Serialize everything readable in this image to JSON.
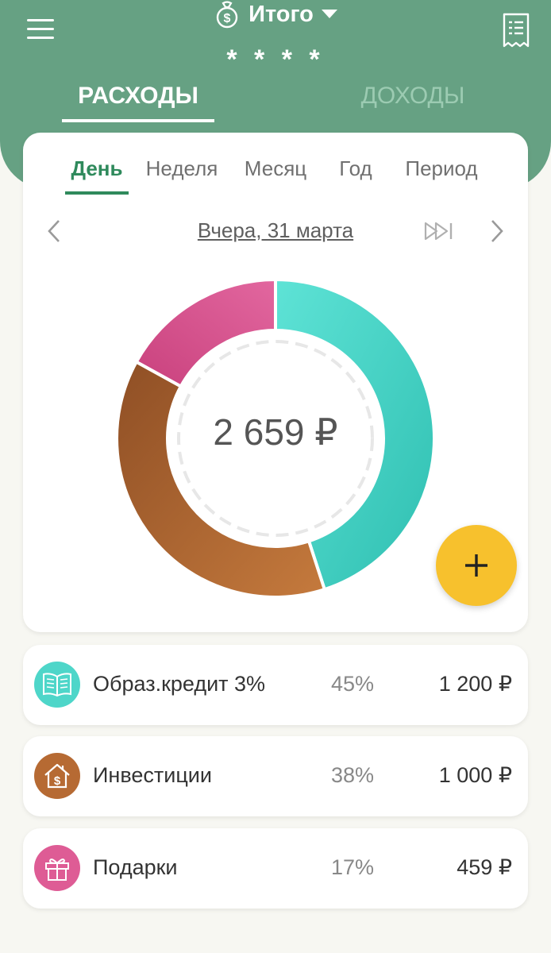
{
  "header": {
    "title": "Итого",
    "masked_balance": "* * * *",
    "tabs": [
      {
        "label": "РАСХОДЫ",
        "active": true
      },
      {
        "label": "ДОХОДЫ",
        "active": false
      }
    ],
    "icons": {
      "menu": "hamburger-icon",
      "wallet": "money-bag-icon",
      "dropdown": "caret-down-icon",
      "receipt": "receipt-icon"
    }
  },
  "period": {
    "tabs": [
      {
        "label": "День",
        "active": true
      },
      {
        "label": "Неделя",
        "active": false
      },
      {
        "label": "Месяц",
        "active": false
      },
      {
        "label": "Год",
        "active": false
      },
      {
        "label": "Период",
        "active": false
      }
    ],
    "date_label": "Вчера, 31 марта"
  },
  "total": "2 659 ₽",
  "chart_data": {
    "type": "pie",
    "categories": [
      "Образ.кредит 3%",
      "Инвестиции",
      "Подарки"
    ],
    "values": [
      45,
      38,
      17
    ],
    "colors": [
      "#3fd4c6",
      "#b0652f",
      "#d84e8b"
    ]
  },
  "categories": [
    {
      "name": "Образ.кредит 3%",
      "percent": "45%",
      "amount": "1 200 ₽",
      "color": "#4ed6c9",
      "icon": "book-icon"
    },
    {
      "name": "Инвестиции",
      "percent": "38%",
      "amount": "1 000 ₽",
      "color": "#b66a33",
      "icon": "house-dollar-icon"
    },
    {
      "name": "Подарки",
      "percent": "17%",
      "amount": "459 ₽",
      "color": "#de5c95",
      "icon": "gift-icon"
    }
  ],
  "colors": {
    "header": "#66a183",
    "accent": "#2f8a5c",
    "fab": "#f7c12d"
  }
}
